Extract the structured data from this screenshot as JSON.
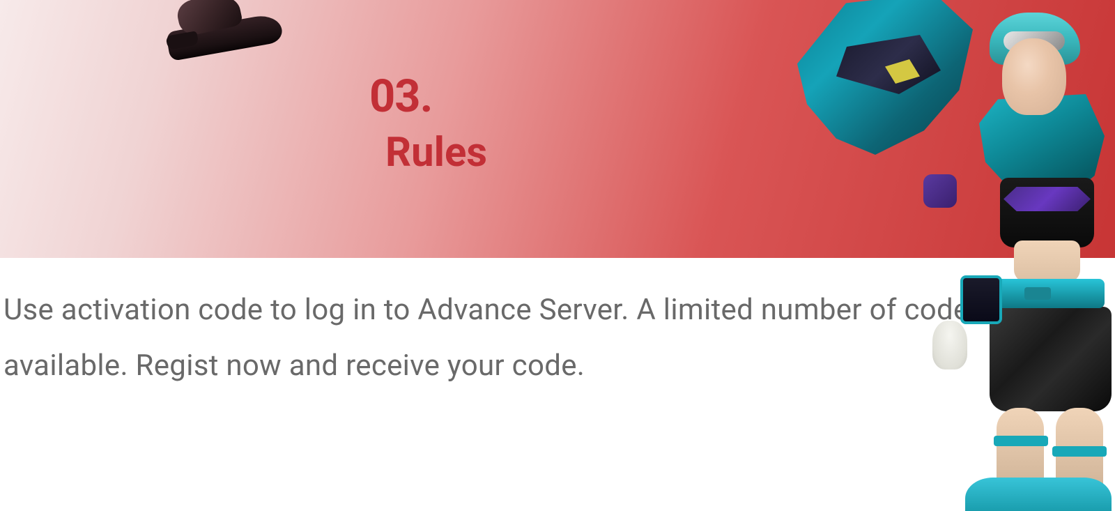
{
  "section": {
    "number": "03.",
    "title": "Rules"
  },
  "content": {
    "description": "Use activation code to log in to Advance Server. A limited number of codes available. Regist now and receive your code."
  },
  "decorations": {
    "bootIcon": "boot-icon",
    "characterFigure": "game-character"
  },
  "colors": {
    "accent": "#c22f36",
    "bodyText": "#696969",
    "heroGradientStart": "#f7eaea",
    "heroGradientEnd": "#c73535"
  }
}
